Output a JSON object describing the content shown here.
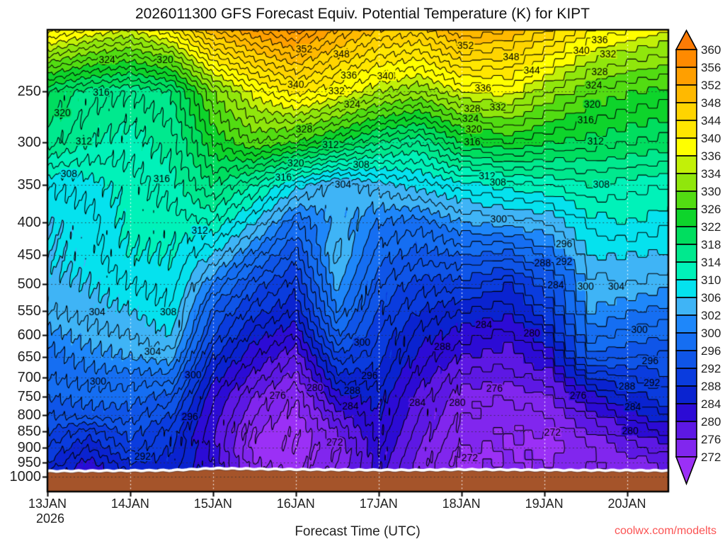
{
  "title": "2026011300 GFS Forecast Equiv. Potential Temperature (K) for KIPT",
  "x_axis": {
    "label": "Forecast Time (UTC)",
    "tick_labels": [
      "13JAN",
      "14JAN",
      "15JAN",
      "16JAN",
      "17JAN",
      "18JAN",
      "19JAN",
      "20JAN"
    ],
    "year_label": "2026"
  },
  "y_axis": {
    "tick_labels": [
      "250",
      "300",
      "350",
      "400",
      "450",
      "500",
      "550",
      "600",
      "650",
      "700",
      "750",
      "800",
      "850",
      "900",
      "950",
      "1000"
    ]
  },
  "watermark": {
    "text": "coolwx.com/modelts",
    "color": "#fb5353"
  },
  "terrain": {
    "color": "#a5542a",
    "surface_pressure_by_time": [
      986,
      985,
      984,
      983,
      976,
      978,
      980,
      981,
      982,
      982,
      980,
      981,
      982,
      983,
      983,
      984
    ]
  },
  "colorbar": {
    "labels": [
      "360",
      "356",
      "352",
      "348",
      "344",
      "340",
      "336",
      "334",
      "330",
      "326",
      "322",
      "318",
      "314",
      "310",
      "306",
      "302",
      "300",
      "296",
      "292",
      "288",
      "284",
      "280",
      "276",
      "272"
    ],
    "fill_colors": [
      "#9b30f6",
      "#8126ee",
      "#5d18e4",
      "#2c0bd5",
      "#0a23d0",
      "#0a3cde",
      "#0f55e8",
      "#156ef2",
      "#1e87fa",
      "#3fb4f6",
      "#05e2ee",
      "#00f2b9",
      "#00e98e",
      "#00de5f",
      "#0ed42b",
      "#52dc12",
      "#90e60c",
      "#c2f008",
      "#ffff00",
      "#ffe600",
      "#ffd400",
      "#ffb900",
      "#ff9f00",
      "#ff8a00",
      "#fb7b05"
    ]
  },
  "chart_data": {
    "type": "heatmap",
    "title": "2026011300 GFS Forecast Equiv. Potential Temperature (K) for KIPT",
    "xlabel": "Forecast Time (UTC)",
    "legend_position": "right-colorbar",
    "grid": "dotted",
    "xlim": [
      13.0,
      20.5
    ],
    "ylim": [
      200,
      1055
    ],
    "y_log": true,
    "x_time_days": [
      13.0,
      13.5,
      14.0,
      14.5,
      15.0,
      15.5,
      16.0,
      16.5,
      17.0,
      17.5,
      18.0,
      18.5,
      19.0,
      19.5,
      20.0,
      20.5
    ],
    "y_pressure_hpa": [
      200,
      250,
      300,
      350,
      400,
      450,
      500,
      550,
      600,
      650,
      700,
      750,
      800,
      850,
      900,
      950,
      1000
    ],
    "values_theta_e_k": [
      [
        341,
        338,
        336,
        340,
        350,
        354,
        357,
        352,
        348,
        347,
        352,
        350,
        346,
        340,
        338,
        336
      ],
      [
        320,
        317,
        316,
        318,
        330,
        337,
        341,
        338,
        334,
        332,
        336,
        337,
        332,
        328,
        326,
        325
      ],
      [
        317,
        314,
        313,
        315,
        324,
        328,
        326,
        322,
        318,
        316,
        322,
        324,
        322,
        321,
        320,
        319
      ],
      [
        308,
        309,
        311,
        313,
        318,
        314,
        307,
        303,
        305,
        307,
        309,
        311,
        312,
        314,
        313,
        312
      ],
      [
        306,
        307,
        311,
        311,
        312,
        306,
        298,
        303,
        300,
        299,
        302,
        303,
        304,
        309,
        310,
        308
      ],
      [
        306,
        307,
        310,
        310,
        306,
        299,
        293,
        305,
        297,
        295,
        296,
        295,
        299,
        306,
        306,
        306
      ],
      [
        305,
        306,
        308,
        309,
        300,
        293,
        289,
        303,
        294,
        291,
        291,
        288,
        294,
        303,
        304,
        302
      ],
      [
        304,
        305,
        306,
        308,
        295,
        289,
        286,
        300,
        292,
        288,
        286,
        285,
        290,
        302,
        300,
        299
      ],
      [
        301,
        303,
        304,
        306,
        292,
        285,
        282,
        296,
        290,
        285,
        283,
        281,
        286,
        299,
        297,
        296
      ],
      [
        299,
        301,
        302,
        303,
        288,
        282,
        278,
        291,
        289,
        283,
        280,
        279,
        282,
        295,
        294,
        293
      ],
      [
        298,
        299,
        299,
        299,
        285,
        279,
        275,
        287,
        287,
        281,
        277,
        277,
        279,
        288,
        290,
        292
      ],
      [
        296,
        297,
        297,
        295,
        282,
        276,
        272,
        283,
        285,
        279,
        275,
        274,
        276,
        283,
        287,
        290
      ],
      [
        294,
        295,
        295,
        292,
        281,
        274,
        271,
        279,
        284,
        278,
        274,
        273,
        274,
        279,
        283,
        287
      ],
      [
        292,
        289,
        293,
        289,
        280,
        272,
        270,
        276,
        283,
        277,
        273,
        272,
        272,
        276,
        280,
        283
      ],
      [
        290,
        286,
        291,
        288,
        281,
        271,
        270,
        274,
        282,
        276,
        272,
        272,
        271,
        274,
        277,
        280
      ],
      [
        288,
        283,
        288,
        287,
        282,
        272,
        271,
        274,
        281,
        275,
        271,
        272,
        272,
        274,
        275,
        277
      ],
      [
        284,
        282,
        285,
        286,
        283,
        274,
        272,
        275,
        280,
        276,
        272,
        273,
        273,
        275,
        274,
        276
      ]
    ],
    "fill_boundaries": [
      272,
      276,
      280,
      284,
      288,
      292,
      296,
      300,
      302,
      306,
      310,
      314,
      318,
      322,
      326,
      330,
      334,
      336,
      340,
      344,
      348,
      352,
      356,
      360
    ],
    "contour_interval": 2,
    "contour_labels": [
      [
        324,
        13.72,
        223
      ],
      [
        320,
        14.42,
        223
      ],
      [
        316,
        13.65,
        251
      ],
      [
        320,
        13.18,
        270
      ],
      [
        312,
        13.44,
        299
      ],
      [
        308,
        13.26,
        337
      ],
      [
        316,
        14.38,
        343
      ],
      [
        312,
        14.84,
        413
      ],
      [
        304,
        13.6,
        553
      ],
      [
        308,
        14.46,
        553
      ],
      [
        304,
        14.27,
        639
      ],
      [
        300,
        13.61,
        710
      ],
      [
        300,
        14.76,
        695
      ],
      [
        296,
        14.72,
        808
      ],
      [
        292,
        14.15,
        931
      ],
      [
        352,
        16.1,
        215
      ],
      [
        348,
        16.55,
        219
      ],
      [
        340,
        16.0,
        244
      ],
      [
        336,
        16.64,
        236
      ],
      [
        344,
        17.11,
        237
      ],
      [
        332,
        16.49,
        250
      ],
      [
        324,
        16.68,
        262
      ],
      [
        328,
        16.1,
        287
      ],
      [
        320,
        16.0,
        324
      ],
      [
        316,
        15.85,
        341
      ],
      [
        312,
        16.42,
        303
      ],
      [
        308,
        16.79,
        326
      ],
      [
        304,
        16.57,
        350
      ],
      [
        276,
        15.78,
        747
      ],
      [
        280,
        16.23,
        728
      ],
      [
        272,
        16.47,
        884
      ],
      [
        284,
        16.66,
        778
      ],
      [
        288,
        16.68,
        734
      ],
      [
        296,
        16.89,
        697
      ],
      [
        300,
        16.8,
        617
      ],
      [
        284,
        17.47,
        768
      ],
      [
        288,
        17.77,
        627
      ],
      [
        352,
        18.05,
        212
      ],
      [
        348,
        18.6,
        221
      ],
      [
        344,
        18.85,
        232
      ],
      [
        340,
        17.08,
        237
      ],
      [
        336,
        18.26,
        247
      ],
      [
        332,
        18.44,
        265
      ],
      [
        328,
        18.13,
        266
      ],
      [
        324,
        18.11,
        276
      ],
      [
        320,
        18.15,
        287
      ],
      [
        316,
        18.13,
        300
      ],
      [
        312,
        18.31,
        339
      ],
      [
        308,
        18.44,
        347
      ],
      [
        340,
        19.45,
        216
      ],
      [
        336,
        19.67,
        208
      ],
      [
        332,
        19.77,
        219
      ],
      [
        328,
        19.67,
        233
      ],
      [
        324,
        19.6,
        245
      ],
      [
        320,
        19.58,
        262
      ],
      [
        316,
        19.5,
        277
      ],
      [
        312,
        19.62,
        299
      ],
      [
        308,
        19.69,
        350
      ],
      [
        300,
        18.45,
        396
      ],
      [
        296,
        19.24,
        433
      ],
      [
        292,
        19.24,
        462
      ],
      [
        288,
        18.98,
        464
      ],
      [
        284,
        19.14,
        502
      ],
      [
        300,
        19.5,
        505
      ],
      [
        304,
        19.87,
        505
      ],
      [
        284,
        18.27,
        579
      ],
      [
        280,
        18.85,
        597
      ],
      [
        276,
        18.4,
        729
      ],
      [
        272,
        18.1,
        936
      ],
      [
        276,
        19.41,
        748
      ],
      [
        272,
        19.1,
        855
      ],
      [
        280,
        17.95,
        768
      ],
      [
        300,
        20.15,
        590
      ],
      [
        296,
        20.28,
        660
      ],
      [
        292,
        20.3,
        715
      ],
      [
        288,
        20.0,
        724
      ],
      [
        284,
        20.07,
        780
      ],
      [
        280,
        20.04,
        850
      ]
    ]
  }
}
